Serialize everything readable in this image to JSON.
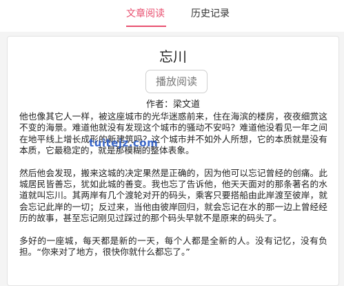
{
  "tabs": {
    "article_read": "文章阅读",
    "history": "历史记录"
  },
  "article": {
    "title": "忘川",
    "play_button": "播放阅读",
    "author": "作者：梁文道",
    "paragraphs": [
      "他也像其它人一样，被这座城市的光华迷惑前来，住在海滨的楼房，夜夜细赏这不变的海景。难道他就没有发现这个城市的骚动不安吗？难道他没看见一年之间在地平线上增长成形的新建筑吗？这个城市并不如外人所想，它的本质就是没有本质，它最稳定的，就是那模糊的整体表象。",
      "然后他会发现，搬来这城的决定果然是正确的，因为他可以忘记曾经的创痛。此城居民皆善忘，犹如此城的善变。我也忘了告诉他，他天天面对的那条著名的水道就叫忘川。其两岸有几个渡轮对开的码头，乘客只要搭船由此岸渡至彼岸，就会忘记此岸的一切；反过来，当他由彼岸回归，就会忘记在水的那一边上曾经经历的故事，甚至忘记刚见过踩过的那个码头早就不是原来的码头了。",
      "多好的一座城，每天都是新的一天，每个人都是全新的人。没有记忆，没有负担。“你来对了地方，很快你就什么都忘了。”"
    ]
  },
  "watermark": "tuitejz.com",
  "colors": {
    "accent": "#e84f6f",
    "watermark": "#1b4fc2"
  }
}
